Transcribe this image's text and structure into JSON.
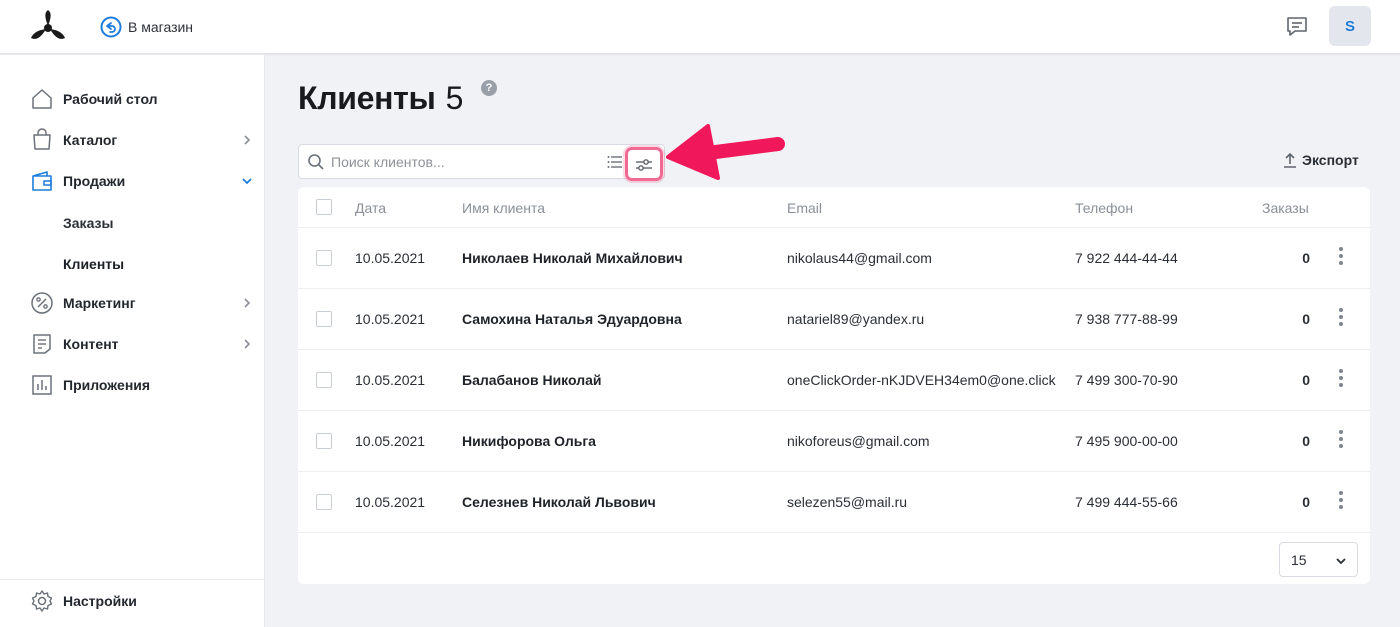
{
  "header": {
    "store_link": "В магазин",
    "avatar_letter": "S"
  },
  "sidebar": {
    "items": [
      {
        "label": "Рабочий стол",
        "icon": "home-icon"
      },
      {
        "label": "Каталог",
        "icon": "bag-icon"
      },
      {
        "label": "Продажи",
        "icon": "wallet-icon"
      },
      {
        "label": "Маркетинг",
        "icon": "percent-icon"
      },
      {
        "label": "Контент",
        "icon": "document-icon"
      },
      {
        "label": "Приложения",
        "icon": "bar-chart-icon"
      }
    ],
    "sales_sub": [
      "Заказы",
      "Клиенты"
    ],
    "settings": "Настройки"
  },
  "main": {
    "title": "Клиенты",
    "count": "5",
    "help": "?",
    "search_placeholder": "Поиск клиентов...",
    "export_label": "Экспорт",
    "per_page": "15"
  },
  "table": {
    "headers": [
      "Дата",
      "Имя клиента",
      "Email",
      "Телефон",
      "Заказы"
    ],
    "rows": [
      {
        "date": "10.05.2021",
        "name": "Николаев Николай Михайлович",
        "email": "nikolaus44@gmail.com",
        "phone": "7 922 444-44-44",
        "orders": "0"
      },
      {
        "date": "10.05.2021",
        "name": "Самохина Наталья Эдуардовна",
        "email": "natariel89@yandex.ru",
        "phone": "7 938 777-88-99",
        "orders": "0"
      },
      {
        "date": "10.05.2021",
        "name": "Балабанов Николай",
        "email": "oneClickOrder-nKJDVEH34em0@one.click",
        "phone": "7 499 300-70-90",
        "orders": "0"
      },
      {
        "date": "10.05.2021",
        "name": "Никифорова Ольга",
        "email": "nikoforeus@gmail.com",
        "phone": "7 495 900-00-00",
        "orders": "0"
      },
      {
        "date": "10.05.2021",
        "name": "Селезнев Николай Львович",
        "email": "selezen55@mail.ru",
        "phone": "7 499 444-55-66",
        "orders": "0"
      }
    ]
  },
  "colors": {
    "accent": "#1e7ddb",
    "highlight": "#f06a93",
    "arrow": "#f0185a"
  }
}
